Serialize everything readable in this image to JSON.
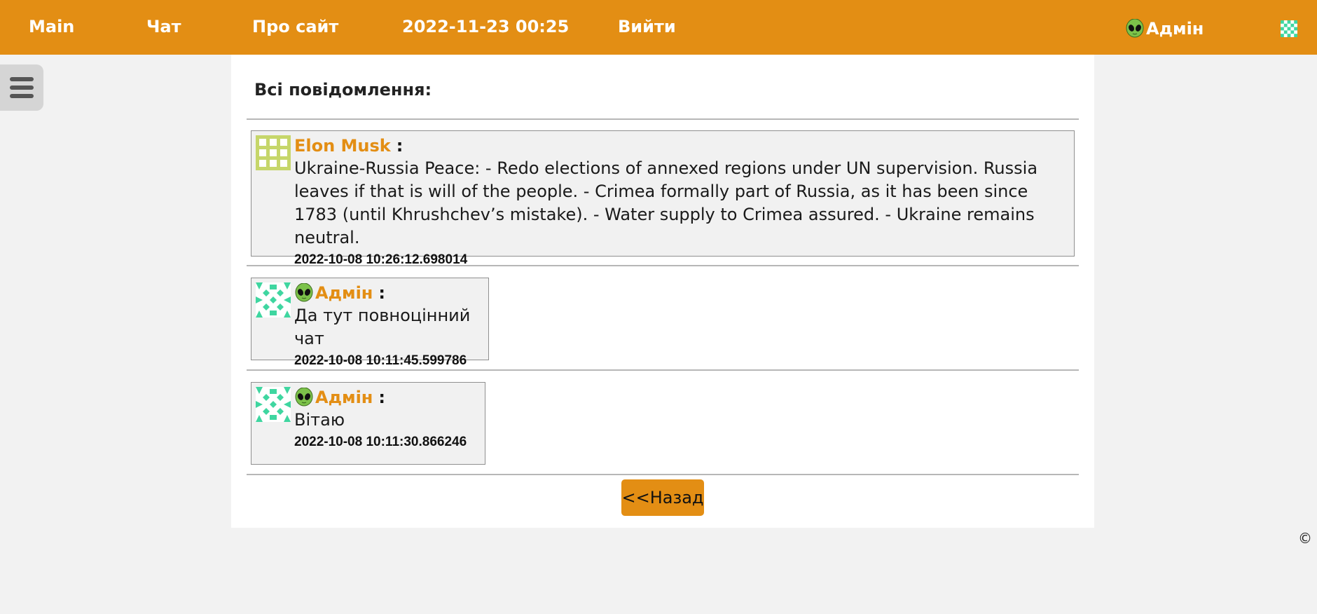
{
  "nav": {
    "main": "Main",
    "chat": "Чат",
    "about": "Про сайт",
    "datetime": "2022-11-23 00:25",
    "logout": "Вийти",
    "user": "Адмін"
  },
  "page": {
    "title": "Всі повідомлення:"
  },
  "messages": [
    {
      "author": "Elon Musk",
      "colon": ":",
      "text": "Ukraine-Russia Peace: - Redo elections of annexed regions under UN supervision. Russia leaves if that is will of the people. - Crimea formally part of Russia, as it has been since 1783 (until Khrushchev’s mistake). - Water supply to Crimea assured. - Ukraine remains neutral.",
      "timestamp": "2022-10-08 10:26:12.698014",
      "avatar_color": "#c6d66a"
    },
    {
      "author": "Адмін",
      "colon": ":",
      "text": "Да тут повноцінний чат",
      "timestamp": "2022-10-08 10:11:45.599786",
      "avatar_color": "#3fd6a0"
    },
    {
      "author": "Адмін",
      "colon": ":",
      "text": "Вітаю",
      "timestamp": "2022-10-08 10:11:30.866246",
      "avatar_color": "#3fd6a0"
    }
  ],
  "back_button": "<<Назад",
  "footer": {
    "copyright": "©"
  },
  "colors": {
    "accent": "#e38e14",
    "background": "#f2f2f2"
  }
}
